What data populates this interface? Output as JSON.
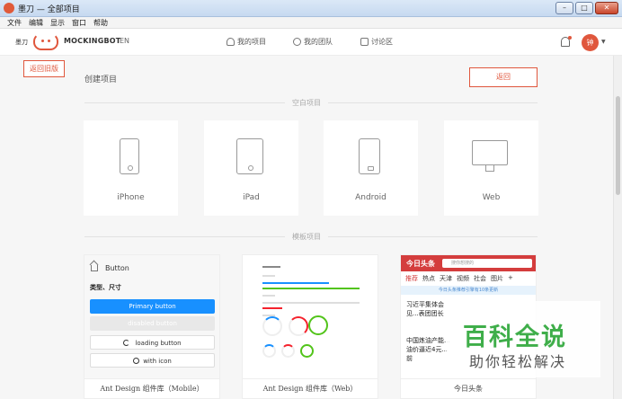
{
  "window": {
    "title": "墨刀 — 全部项目",
    "controls": [
      "–",
      "□",
      "✕"
    ]
  },
  "menu": [
    "文件",
    "编辑",
    "显示",
    "窗口",
    "帮助"
  ],
  "header": {
    "brand_cn": "墨刀",
    "brand_en": "MOCKINGBOT",
    "lang": "EN",
    "nav": {
      "projects": "我的项目",
      "team": "我的团队",
      "forum": "讨论区"
    },
    "avatar_text": "钟",
    "accent": "#e0573d"
  },
  "main": {
    "old_version_button": "返回旧版",
    "create_title": "创建项目",
    "back_button": "返回",
    "blank_section": "空白项目",
    "template_section": "模板项目",
    "devices": [
      "iPhone",
      "iPad",
      "Android",
      "Web"
    ]
  },
  "templates": {
    "t1": {
      "caption": "Ant Design 组件库（Mobile）",
      "header": "Button",
      "subtitle": "类型、尺寸",
      "primary": "Primary button",
      "disabled": "disabled button",
      "loading": "loading button",
      "with_icon": "with icon"
    },
    "t2": {
      "caption": "Ant Design 组件库（Web）"
    },
    "t3": {
      "caption": "今日头条",
      "logo": "今日头条",
      "search": "搜你想搜的",
      "tabs": [
        "推荐",
        "热点",
        "天津",
        "视频",
        "社会",
        "图片",
        "+"
      ],
      "tip": "今日头条推荐引擎有10条更新",
      "news1": "习近平集体会见...表团团长",
      "news2": "中国炼油产能...油价逼近4元...前"
    }
  },
  "watermark": {
    "title": "百科全说",
    "subtitle": "助你轻松解决"
  }
}
